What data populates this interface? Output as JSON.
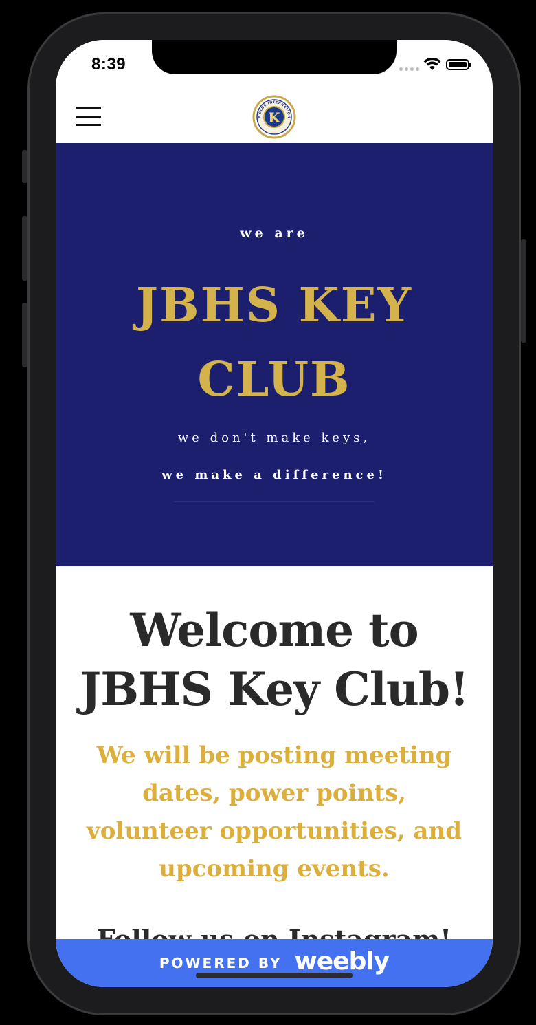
{
  "status_bar": {
    "time": "8:39",
    "icons": [
      "signal-icon",
      "wifi-icon",
      "battery-icon"
    ]
  },
  "header": {
    "menu_icon": "hamburger-menu-icon",
    "logo_text": "KEY CLUB INTERNATIONAL",
    "logo_letter": "K"
  },
  "hero": {
    "kicker": "we are",
    "title_line1": "JBHS KEY",
    "title_line2": "CLUB",
    "subtitle_line1": "we don't make keys,",
    "subtitle_line2": "we make a difference!",
    "background_color": "#1b1f6e",
    "title_color": "#d4b24c"
  },
  "content": {
    "welcome_line1": "Welcome to",
    "welcome_line2": "JBHS Key Club!",
    "body_line1": "We will be posting meeting",
    "body_line2": "dates, power points,",
    "body_line3": "volunteer opportunities, and",
    "body_line4": "upcoming events.",
    "follow_heading": "Follow us on Instagram!",
    "body_color": "#dcae3c"
  },
  "footer": {
    "powered_by": "POWERED BY",
    "brand": "weebly",
    "background_color": "#4471f0"
  }
}
